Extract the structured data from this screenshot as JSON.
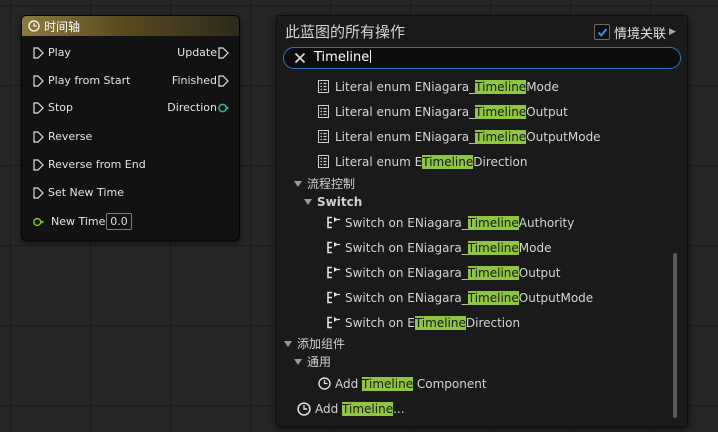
{
  "node": {
    "title": "时间轴",
    "left_pins": [
      "Play",
      "Play from Start",
      "Stop",
      "Reverse",
      "Reverse from End",
      "Set New Time"
    ],
    "right_pins": [
      "Update",
      "Finished",
      "Direction"
    ],
    "new_time_label": "New Time",
    "new_time_value": "0.0"
  },
  "panel": {
    "title": "此蓝图的所有操作",
    "context_label": "情境关联",
    "search_value": "Timeline"
  },
  "items": {
    "enum1": {
      "pre": "Literal enum ENiagara_",
      "hl": "Timeline",
      "post": "Mode"
    },
    "enum2": {
      "pre": "Literal enum ENiagara_",
      "hl": "Timeline",
      "post": "Output"
    },
    "enum3": {
      "pre": "Literal enum ENiagara_",
      "hl": "Timeline",
      "post": "OutputMode"
    },
    "enum4": {
      "pre": "Literal enum E",
      "hl": "Timeline",
      "post": "Direction"
    },
    "cat_flow": "流程控制",
    "cat_switch": "Switch",
    "sw1": {
      "pre": "Switch on ENiagara_",
      "hl": "Timeline",
      "post": "Authority"
    },
    "sw2": {
      "pre": "Switch on ENiagara_",
      "hl": "Timeline",
      "post": "Mode"
    },
    "sw3": {
      "pre": "Switch on ENiagara_",
      "hl": "Timeline",
      "post": "Output"
    },
    "sw4": {
      "pre": "Switch on ENiagara_",
      "hl": "Timeline",
      "post": "OutputMode"
    },
    "sw5": {
      "pre": "Switch on E",
      "hl": "Timeline",
      "post": "Direction"
    },
    "cat_add": "添加组件",
    "cat_common": "通用",
    "add_comp": {
      "pre": "Add ",
      "hl": "Timeline",
      "post": " Component"
    },
    "add_tl": {
      "pre": "Add ",
      "hl": "Timeline",
      "post": "..."
    }
  },
  "colors": {
    "highlight": "#8dc63f",
    "search_border": "#2f73c9",
    "exec_pin": "#e0e0e0",
    "direction_pin": "#2fb7a3",
    "float_pin": "#7ed321"
  }
}
